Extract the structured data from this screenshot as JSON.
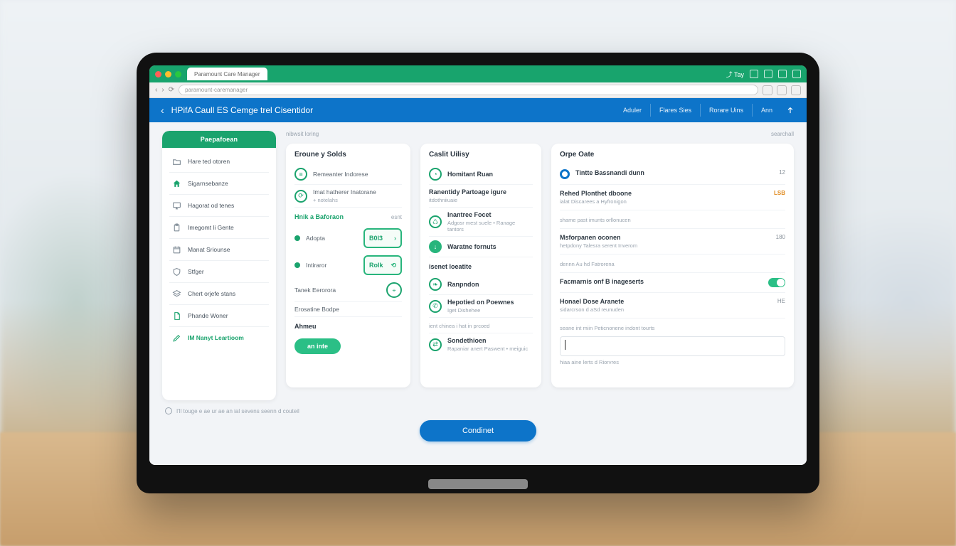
{
  "browser": {
    "tab_title": "Paramount Care Manager",
    "address": "paramount-caremanager",
    "toolbar_label": "Tay"
  },
  "header": {
    "title": "HPifA Caull ES Cemge trel Cisentidor",
    "nav": [
      "Aduler",
      "Flares Sies",
      "Rorare Uins",
      "Ann"
    ]
  },
  "breadcrumb_left": "nibwsit loring",
  "breadcrumb_right": "searchall",
  "sidebar": {
    "heading": "Paepafoean",
    "items": [
      {
        "icon": "folder",
        "label": "Hare ted otoren"
      },
      {
        "icon": "home",
        "label": "Sigarnsebanze"
      },
      {
        "icon": "monitor",
        "label": "Hagorat od tenes"
      },
      {
        "icon": "clipboard",
        "label": "Imegomt li Gente"
      },
      {
        "icon": "calendar",
        "label": "Manat Sriounse"
      },
      {
        "icon": "shield",
        "label": "Stfger"
      },
      {
        "icon": "layers",
        "label": "Chert orjefe stans"
      },
      {
        "icon": "file",
        "label": "Phande Woner"
      },
      {
        "icon": "edit",
        "label": "IM Nanyt Leartioom",
        "accent": true
      }
    ]
  },
  "panel_a": {
    "title": "Eroune y Solds",
    "rows": [
      {
        "icon": "doc",
        "label": "Remeanter Indorese"
      },
      {
        "icon": "refresh",
        "label": "Imat hatherer Inatorane",
        "sub": "+ notelahs"
      }
    ],
    "section2": "Hnik a Baforaon",
    "section2_badge": "esnt",
    "opt1": "Adopta",
    "chip1": "B0I3",
    "opt2": "Intiraror",
    "chip2": "Rolk",
    "section3_a": "Tanek Eerorora",
    "section3_b": "Erosatine Bodpe",
    "section4": "Ahmeu",
    "action": "an inte"
  },
  "panel_b": {
    "title": "Caslit Uilisy",
    "rows": [
      {
        "icon": "clock",
        "tt": "Homitant Ruan"
      },
      {
        "tt": "Ranentidy Partoage igure",
        "sub": "itdothniiuaie"
      },
      {
        "icon": "recycle",
        "tt": "Inantree Focet",
        "sub": "Adgosr mest suele • Ranage tantors"
      },
      {
        "icon": "arrow",
        "fill": true,
        "tt": "Waratne fornuts"
      }
    ],
    "section2": "isenet loeatite",
    "rows2": [
      {
        "icon": "leaf",
        "tt": "Ranpndon"
      },
      {
        "icon": "phone",
        "tt": "Hepotied on Poewnes",
        "sub": "Iget Dishehee"
      },
      {
        "plain": true,
        "sub": "ient chinea i hat in prcoed"
      },
      {
        "icon": "swap",
        "tt": "Sondethioen",
        "sub": "Rapaniar anert Paswent • meiguic"
      }
    ]
  },
  "panel_c": {
    "title": "Orpe Oate",
    "rows": [
      {
        "bullet": "blue",
        "tt": "Tintte Bassnandi dunn",
        "val": "12"
      },
      {
        "tt": "Rehed Plonthet dboone",
        "sub": "ialat Discarees a Hyfronigon",
        "val": "LSB",
        "orange": true
      },
      {
        "sub": "shame past imunts orllonucen"
      },
      {
        "tt": "Msforpanen oconen",
        "sub": "hetpdony Talesra serent Inverom",
        "val": "180"
      },
      {
        "sub": "dennn Au hd Fatrorena"
      },
      {
        "tt": "Facmarnis onf B inageserts",
        "toggle": true
      },
      {
        "tt": "Honael Dose Aranete",
        "sub": "sidarcrson d aSd reunuden",
        "val": "HE"
      },
      {
        "sub": "seane int miin Peticnonene indont tourts"
      }
    ],
    "note": "hiaa aine lerts d Riorvres"
  },
  "agree_text": "I'll touge e ae ur ae an ial sevens seenn d couteil",
  "primary_action": "Condinet"
}
